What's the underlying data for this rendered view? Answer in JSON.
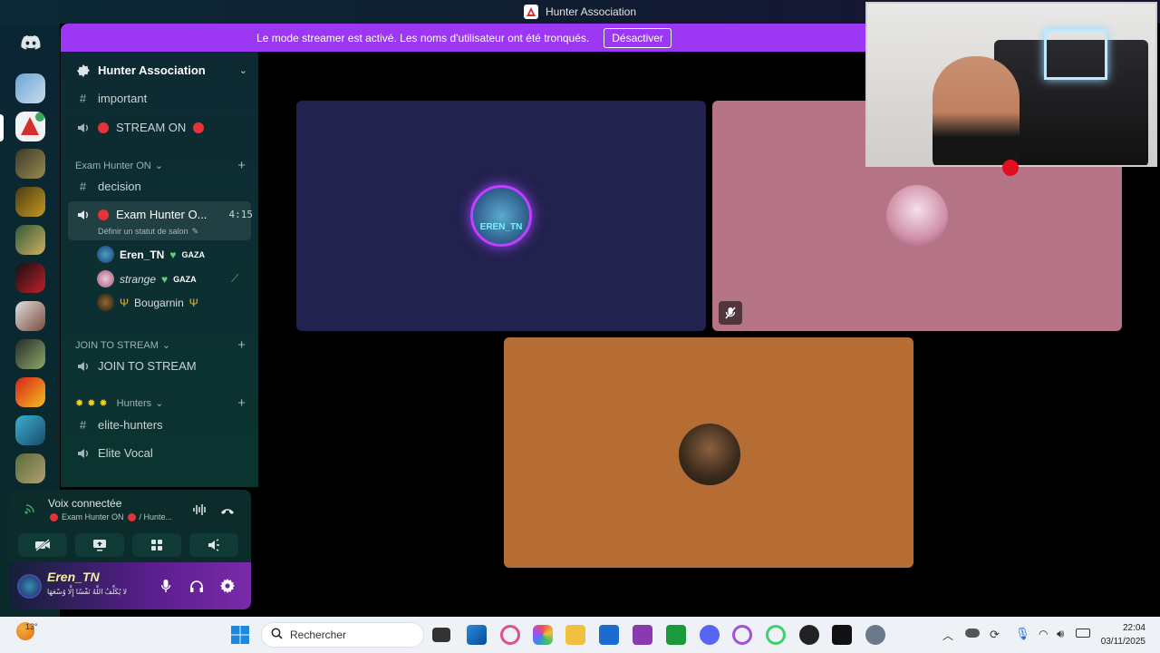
{
  "window": {
    "title": "Hunter Association"
  },
  "banner": {
    "message": "Le mode streamer est activé. Les noms d'utilisateur ont été tronqués.",
    "button_label": "Désactiver"
  },
  "sidebar": {
    "server_name": "Hunter Association",
    "channels_top": [
      {
        "type": "text",
        "name": "important"
      },
      {
        "type": "voice",
        "name": "STREAM ON"
      }
    ],
    "categories": [
      {
        "name": "Exam Hunter ON"
      },
      {
        "name": "JOIN TO STREAM"
      },
      {
        "name": "Hunters"
      }
    ],
    "decision_channel": "decision",
    "active_channel": {
      "name": "Exam Hunter O...",
      "timer": "4:15",
      "status_hint": "Définir un statut de salon"
    },
    "members": [
      {
        "name": "Eren_TN",
        "tag": "GAZA"
      },
      {
        "name": "strange",
        "tag": "GAZA"
      },
      {
        "name": "Bougarnin",
        "tag": ""
      }
    ],
    "join_channel": "JOIN TO STREAM",
    "elite_text": "elite-hunters",
    "elite_voice": "Elite Vocal"
  },
  "voice_panel": {
    "status": "Voix connectée",
    "channel": "Exam Hunter ON",
    "server_short": "/ Hunte..."
  },
  "user_panel": {
    "username": "Eren_TN",
    "custom_status": "لا يُكَلِّفُ اللَّهُ نَفْسًا إِلَّا وُسْعَهَا"
  },
  "tiles": [
    {
      "id": "eren",
      "label": "EREN_TN",
      "color": "#22224e"
    },
    {
      "id": "strange",
      "label": "",
      "color": "#b67587"
    },
    {
      "id": "bougarnin",
      "label": "",
      "color": "#b56d34"
    }
  ],
  "taskbar": {
    "weather": "13°",
    "search_placeholder": "Rechercher",
    "time": "22:04",
    "date": "03/11/2025"
  },
  "colors": {
    "banner": "#9c37f3",
    "accent_red": "#e8323a",
    "tile_eren": "#22224e",
    "tile_strange": "#b67587",
    "tile_bougarnin": "#b56d34"
  }
}
